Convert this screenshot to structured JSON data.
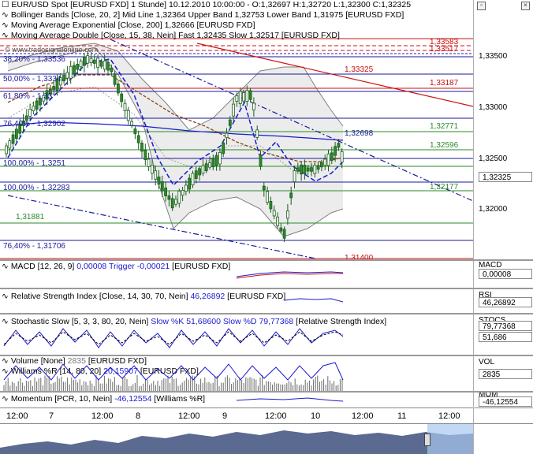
{
  "main": {
    "title": "EUR/USD Spot [EURUSD FXD]  1 Stunde] 10.12.2010 10:00:00 - O:1,32697 H:1,32720 L:1,32300 C:1,32325",
    "legend": [
      {
        "text": "Bollinger Bands [Close, 20, 2] Mid Line 1,32364 Upper Band 1,32753 Lower Band 1,31975 [EURUSD FXD]"
      },
      {
        "text": "Moving Average Exponential [Close, 200] 1,32666 [EURUSD FXD]"
      },
      {
        "text": "Moving Average Double [Close, 15, 38, Nein] Fast 1,32435 Slow 1,32517 [EURUSD FXD]"
      }
    ],
    "watermark": "© www.tradesignalonline.com",
    "fib_labels": [
      "38,20% - 1,33536",
      "50,00% - 1,3334",
      "61,80% - 1,33",
      "76,40% - 1,32902",
      "100,00% - 1,3251",
      "100,00% - 1,32283",
      "76,40% - 1,31706"
    ],
    "level_labels": [
      "1,33583",
      "1,33517",
      "1,33325",
      "1,33187",
      "1,32771",
      "1,32698",
      "1,32596",
      "1,32177",
      "1,31881",
      "1,31400"
    ],
    "price_axis": [
      "1,33500",
      "1,33000",
      "1,32500",
      "1,32000"
    ],
    "current_price": "1,32325",
    "colors": {
      "candle": "#2b8a2b",
      "bollinger": "#808080",
      "fib": "#1a1a9a",
      "resistance": "#cc1111",
      "support": "#2a8a2a",
      "ema": "#1a1ad0",
      "dma_fast": "#1a1ad0",
      "dma_slow": "#8b4513"
    }
  },
  "indicators": [
    {
      "id": "macd",
      "label": "MACD [12, 26, 9]",
      "value1": "0,00008",
      "trigger_label": "Trigger",
      "value2": "-0,00021",
      "suffix": "[EURUSD FXD]",
      "axis_name": "MACD",
      "axis_value": "0,00008"
    },
    {
      "id": "rsi",
      "label": "Relative Strength Index [Close, 14, 30, 70, Nein]",
      "value1": "46,26892",
      "suffix": "[EURUSD FXD]",
      "axis_name": "RSI",
      "axis_value": "46,26892"
    },
    {
      "id": "stoch",
      "label": "Stochastic Slow [5, 3, 3, 80, 20, Nein]",
      "k_label": "Slow %K",
      "value1": "51,68600",
      "d_label": "Slow %D",
      "value2": "79,77368",
      "suffix": "[Relative Strength Index]",
      "axis_name": "STOCS",
      "axis_value": "79,77368",
      "axis_value2": "51,686"
    },
    {
      "id": "volume",
      "label": "Volume [None]",
      "value1": "2835",
      "suffix": "[EURUSD FXD]",
      "label2": "Williams %R [14, 80, 20]",
      "value2": "20,15907",
      "suffix2": "[EURUSD FXD]",
      "axis_name": "VOL",
      "axis_value": "2835"
    },
    {
      "id": "momentum",
      "label": "Momentum [PCR, 10, Nein]",
      "value1": "-46,12554",
      "suffix": "[Williams %R]",
      "axis_name": "MOM",
      "axis_value": "-46,12554"
    }
  ],
  "time_axis": [
    "12:00",
    "7",
    "12:00",
    "8",
    "12:00",
    "9",
    "12:00",
    "10",
    "12:00",
    "11",
    "12:00"
  ]
}
